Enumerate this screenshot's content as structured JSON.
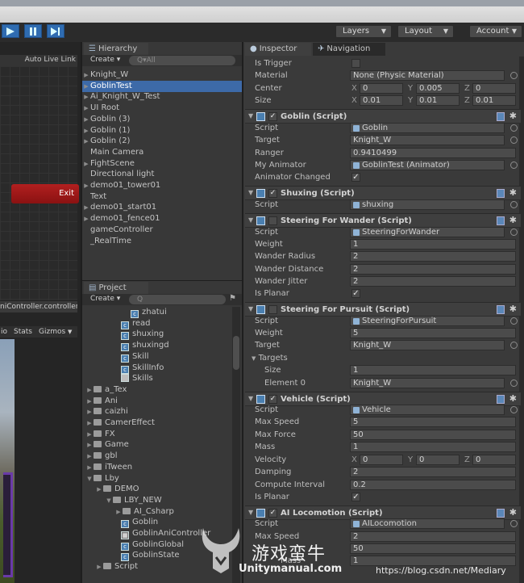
{
  "toolbar": {
    "layers_label": "Layers",
    "layout_label": "Layout",
    "account_label": "Account"
  },
  "scene": {
    "auto_live_link": "Auto Live Link",
    "exit_button": "Exit",
    "controller_label": "niController.controller",
    "game_tab_left": "io",
    "stats_label": "Stats",
    "gizmos_label": "Gizmos"
  },
  "hierarchy": {
    "tab_label": "Hierarchy",
    "create_label": "Create",
    "search_placeholder": "Q▾All",
    "items": [
      {
        "label": "Knight_W",
        "expandable": true,
        "selected": false
      },
      {
        "label": "GoblinTest",
        "expandable": true,
        "selected": true
      },
      {
        "label": "Ai_Knight_W_Test",
        "expandable": true,
        "selected": false
      },
      {
        "label": "UI Root",
        "expandable": true,
        "selected": false
      },
      {
        "label": "Goblin (3)",
        "expandable": true,
        "selected": false
      },
      {
        "label": "Goblin (1)",
        "expandable": true,
        "selected": false
      },
      {
        "label": "Goblin (2)",
        "expandable": true,
        "selected": false
      },
      {
        "label": "Main Camera",
        "expandable": false,
        "selected": false
      },
      {
        "label": "FightScene",
        "expandable": true,
        "selected": false
      },
      {
        "label": "Directional light",
        "expandable": false,
        "selected": false
      },
      {
        "label": "demo01_tower01",
        "expandable": true,
        "selected": false
      },
      {
        "label": "Text",
        "expandable": false,
        "selected": false
      },
      {
        "label": "demo01_start01",
        "expandable": true,
        "selected": false
      },
      {
        "label": "demo01_fence01",
        "expandable": true,
        "selected": false
      },
      {
        "label": "gameController",
        "expandable": false,
        "selected": false
      },
      {
        "label": "_RealTime",
        "expandable": false,
        "selected": false
      }
    ]
  },
  "project": {
    "tab_label": "Project",
    "create_label": "Create",
    "items": [
      {
        "label": "zhatui",
        "type": "script"
      },
      {
        "label": "read",
        "type": "script"
      },
      {
        "label": "shuxing",
        "type": "script"
      },
      {
        "label": "shuxingd",
        "type": "script"
      },
      {
        "label": "Skill",
        "type": "script"
      },
      {
        "label": "SkillInfo",
        "type": "script"
      },
      {
        "label": "Skills",
        "type": "file"
      },
      {
        "label": "a_Tex",
        "type": "folder"
      },
      {
        "label": "Ani",
        "type": "folder"
      },
      {
        "label": "caizhi",
        "type": "folder"
      },
      {
        "label": "CamerEffect",
        "type": "folder"
      },
      {
        "label": "FX",
        "type": "folder"
      },
      {
        "label": "Game",
        "type": "folder"
      },
      {
        "label": "gbl",
        "type": "folder"
      },
      {
        "label": "iTween",
        "type": "folder"
      },
      {
        "label": "Lby",
        "type": "folder"
      },
      {
        "label": "DEMO",
        "type": "folder"
      },
      {
        "label": "LBY_NEW",
        "type": "folder"
      },
      {
        "label": "AI_Csharp",
        "type": "folder"
      },
      {
        "label": "Goblin",
        "type": "script"
      },
      {
        "label": "GoblinAniController",
        "type": "anim"
      },
      {
        "label": "GoblinGlobal",
        "type": "script"
      },
      {
        "label": "GoblinState",
        "type": "script"
      },
      {
        "label": "Script",
        "type": "folder"
      }
    ]
  },
  "inspector": {
    "tab_label": "Inspector",
    "nav_tab_label": "Navigation",
    "collider": {
      "is_trigger": "Is Trigger",
      "material_label": "Material",
      "material_value": "None (Physic Material)",
      "center_label": "Center",
      "center": {
        "x": "0",
        "y": "0.005",
        "z": "0"
      },
      "size_label": "Size",
      "size": {
        "x": "0.01",
        "y": "0.01",
        "z": "0.01"
      }
    },
    "goblin": {
      "title": "Goblin (Script)",
      "script_label": "Script",
      "script_value": "Goblin",
      "target_label": "Target",
      "target_value": "Knight_W",
      "ranger_label": "Ranger",
      "ranger_value": "0.9410499",
      "animator_label": "My Animator",
      "animator_value": "GoblinTest (Animator)",
      "animator_changed_label": "Animator Changed"
    },
    "shuxing": {
      "title": "Shuxing (Script)",
      "script_label": "Script",
      "script_value": "shuxing"
    },
    "wander": {
      "title": "Steering For Wander (Script)",
      "script_label": "Script",
      "script_value": "SteeringForWander",
      "weight_label": "Weight",
      "weight_value": "1",
      "radius_label": "Wander Radius",
      "radius_value": "2",
      "distance_label": "Wander Distance",
      "distance_value": "2",
      "jitter_label": "Wander Jitter",
      "jitter_value": "2",
      "planar_label": "Is Planar"
    },
    "pursuit": {
      "title": "Steering For Pursuit (Script)",
      "script_label": "Script",
      "script_value": "SteeringForPursuit",
      "weight_label": "Weight",
      "weight_value": "5",
      "target_label": "Target",
      "target_value": "Knight_W",
      "targets_label": "Targets",
      "size_label": "Size",
      "size_value": "1",
      "element_label": "Element 0",
      "element_value": "Knight_W"
    },
    "vehicle": {
      "title": "Vehicle (Script)",
      "script_label": "Script",
      "script_value": "Vehicle",
      "max_speed_label": "Max Speed",
      "max_speed_value": "5",
      "max_force_label": "Max Force",
      "max_force_value": "50",
      "mass_label": "Mass",
      "mass_value": "1",
      "velocity_label": "Velocity",
      "velocity": {
        "x": "0",
        "y": "0",
        "z": "0"
      },
      "damping_label": "Damping",
      "damping_value": "2",
      "interval_label": "Compute Interval",
      "interval_value": "0.2",
      "planar_label": "Is Planar"
    },
    "locomotion": {
      "title": "AI Locomotion (Script)",
      "script_label": "Script",
      "script_value": "AILocomotion",
      "max_speed_label": "Max Speed",
      "max_speed_value": "2",
      "max_force_value": "50",
      "mass_label": "Mass",
      "mass_value": "1"
    }
  },
  "watermark": {
    "chinese": "游戏蛮牛",
    "site": "Unitymanual.com",
    "blog": "https://blog.csdn.net/Mediary"
  }
}
